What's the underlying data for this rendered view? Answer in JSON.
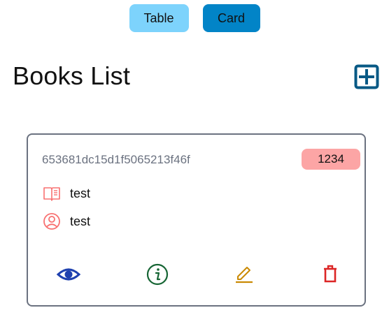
{
  "view_toggle": {
    "table_label": "Table",
    "card_label": "Card"
  },
  "page_title": "Books List",
  "books": [
    {
      "id": "653681dc15d1f5065213f46f",
      "publish_year": "1234",
      "title": "test",
      "author": "test"
    }
  ],
  "icons": {
    "add": "plus-square-icon",
    "book": "open-book-icon",
    "author": "user-circle-icon",
    "view": "eye-icon",
    "info": "info-circle-icon",
    "edit": "edit-pencil-icon",
    "delete": "trash-icon"
  },
  "colors": {
    "table_button": "#7dd3fc",
    "card_button": "#0284c7",
    "add_icon": "#075985",
    "badge": "#fca5a5",
    "row_icons": "#f87171",
    "view_icon": "#1e40af",
    "info_icon": "#166534",
    "edit_icon": "#ca8a04",
    "delete_icon": "#dc2626"
  }
}
